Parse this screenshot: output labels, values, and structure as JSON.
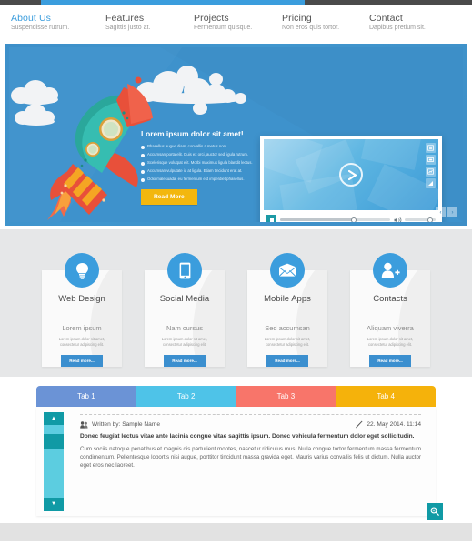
{
  "nav": {
    "items": [
      {
        "label": "About Us",
        "sub": "Suspendisse rutrum.",
        "active": true
      },
      {
        "label": "Features",
        "sub": "Sagittis justo at.",
        "active": false
      },
      {
        "label": "Projects",
        "sub": "Fermentum quisque.",
        "active": false
      },
      {
        "label": "Pricing",
        "sub": "Non eros quis tortor.",
        "active": false
      },
      {
        "label": "Contact",
        "sub": "Dapibus pretium sit.",
        "active": false
      }
    ]
  },
  "hero": {
    "heading": "Lorem ipsum dolor sit amet!",
    "bullets": [
      "Phasellus augue diam, convallis a metus non.",
      "Accumsan porta elit. Duis ex orci, auctor sed ligula rutrum.",
      "Scelerisque volutpat elit. Morbi maximus ligula blandit lectus.",
      "Accumsan vulputate id at ligula. Etiam tincidunt erat at.",
      "Odio malesuada, eu fermentum est imperdiet phasellus."
    ],
    "cta": "Read More",
    "prev_label": "‹",
    "next_label": "›",
    "accent_color": "#3b9ddd",
    "cta_color": "#f3b70e"
  },
  "player": {
    "play_label": "play-button",
    "side_icons": [
      "list-icon",
      "screen-icon",
      "chart-icon",
      "signal-icon"
    ],
    "stop_label": "stop-button",
    "seek_percent": 67,
    "volume_percent": 82
  },
  "services": [
    {
      "icon": "lightbulb-icon",
      "title": "Web Design",
      "subtitle": "Lorem ipsum",
      "desc": "Lorem ipsum dolor sit amet, consectetur adipiscing elit.",
      "button": "Read more..."
    },
    {
      "icon": "mobile-phone-icon",
      "title": "Social Media",
      "subtitle": "Nam cursus",
      "desc": "Lorem ipsum dolor sit amet, consectetur adipiscing elit.",
      "button": "Read more..."
    },
    {
      "icon": "envelope-icon",
      "title": "Mobile Apps",
      "subtitle": "Sed accumsan",
      "desc": "Lorem ipsum dolor sit amet, consectetur adipiscing elit.",
      "button": "Read more..."
    },
    {
      "icon": "add-user-icon",
      "title": "Contacts",
      "subtitle": "Aliquam viverra",
      "desc": "Lorem ipsum dolor sit amet, consectetur adipiscing elit.",
      "button": "Read more..."
    }
  ],
  "tabs": [
    {
      "label": "Tab 1",
      "color": "#6b93d6",
      "active": true
    },
    {
      "label": "Tab 2",
      "color": "#4ec3e8",
      "active": false
    },
    {
      "label": "Tab 3",
      "color": "#f8756a",
      "active": false
    },
    {
      "label": "Tab 4",
      "color": "#f5b20b",
      "active": false
    }
  ],
  "article": {
    "author_label": "Written by: Sample Name",
    "date_label": "22. May 2014.  11:14",
    "lead": "Donec feugiat lectus vitae ante lacinia congue vitae sagittis ipsum. Donec vehicula fermentum dolor eget sollicitudin.",
    "body": "Cum sociis natoque penatibus et magnis dis parturient montes, nascetur ridiculus mus. Nulla congue tortor fermentum massa fermentum condimentum. Pellentesque lobortis nisi augue, porttitor tincidunt massa gravida eget. Mauris varius convallis felis ut dictum. Nulla auctor eget eros nec laoreet.",
    "scroll_up": "▲",
    "scroll_down": "▼",
    "search_label": "search-button"
  }
}
